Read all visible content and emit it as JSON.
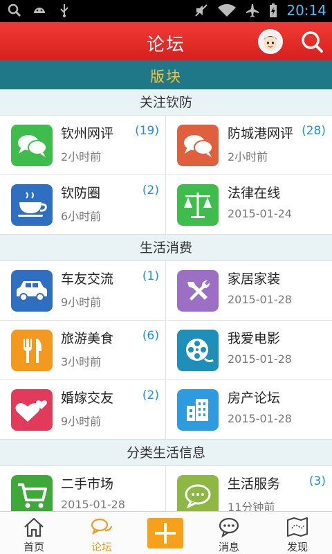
{
  "status_bar": {
    "time": "20:14",
    "icons": [
      "search-icon",
      "android-icon",
      "usb-icon",
      "mute-icon",
      "wifi-icon",
      "airplane-icon",
      "battery-charging-icon"
    ]
  },
  "header": {
    "title": "论坛",
    "brand_color": "#e02b27"
  },
  "section": {
    "title": "版块",
    "background": "#1f7887",
    "title_color": "#f7c236"
  },
  "groups": [
    {
      "title": "关注钦防",
      "items": [
        {
          "name": "钦州网评",
          "time": "2小时前",
          "count": "(19)",
          "icon": "chat-bubbles-icon",
          "color": "#3fbd4c"
        },
        {
          "name": "防城港网评",
          "time": "2小时前",
          "count": "(28)",
          "icon": "chat-bubbles-icon",
          "color": "#e0603d"
        },
        {
          "name": "钦防圈",
          "time": "6小时前",
          "count": "(2)",
          "icon": "coffee-cup-icon",
          "color": "#2f6fc1"
        },
        {
          "name": "法律在线",
          "time": "2015-01-24",
          "count": "",
          "icon": "scales-icon",
          "color": "#3fbd4c"
        }
      ]
    },
    {
      "title": "生活消费",
      "items": [
        {
          "name": "车友交流",
          "time": "9小时前",
          "count": "(1)",
          "icon": "car-icon",
          "color": "#2f6fc1"
        },
        {
          "name": "家居家装",
          "time": "2015-01-28",
          "count": "",
          "icon": "tools-icon",
          "color": "#9b6fc3"
        },
        {
          "name": "旅游美食",
          "time": "3小时前",
          "count": "(6)",
          "icon": "fork-knife-icon",
          "color": "#f39a1e"
        },
        {
          "name": "我爱电影",
          "time": "2015-01-28",
          "count": "",
          "icon": "film-reel-icon",
          "color": "#1e8fb9"
        },
        {
          "name": "婚嫁交友",
          "time": "9小时前",
          "count": "(2)",
          "icon": "hearts-icon",
          "color": "#e23a5a"
        },
        {
          "name": "房产论坛",
          "time": "2015-01-28",
          "count": "",
          "icon": "buildings-icon",
          "color": "#2d9be0"
        }
      ]
    },
    {
      "title": "分类生活信息",
      "items": [
        {
          "name": "二手市场",
          "time": "2015-01-28",
          "count": "",
          "icon": "shopping-cart-icon",
          "color": "#3fa83a"
        },
        {
          "name": "生活服务",
          "time": "11分钟前",
          "count": "(3)",
          "icon": "speech-bubble-icon",
          "color": "#8db843"
        }
      ]
    }
  ],
  "tabbar": {
    "active_color": "#f39a1e",
    "tabs": [
      {
        "label": "首页",
        "icon": "home-icon"
      },
      {
        "label": "论坛",
        "icon": "forum-icon",
        "active": true
      },
      {
        "label": "",
        "icon": "add-icon"
      },
      {
        "label": "消息",
        "icon": "message-icon"
      },
      {
        "label": "发现",
        "icon": "discover-map-icon"
      }
    ]
  }
}
